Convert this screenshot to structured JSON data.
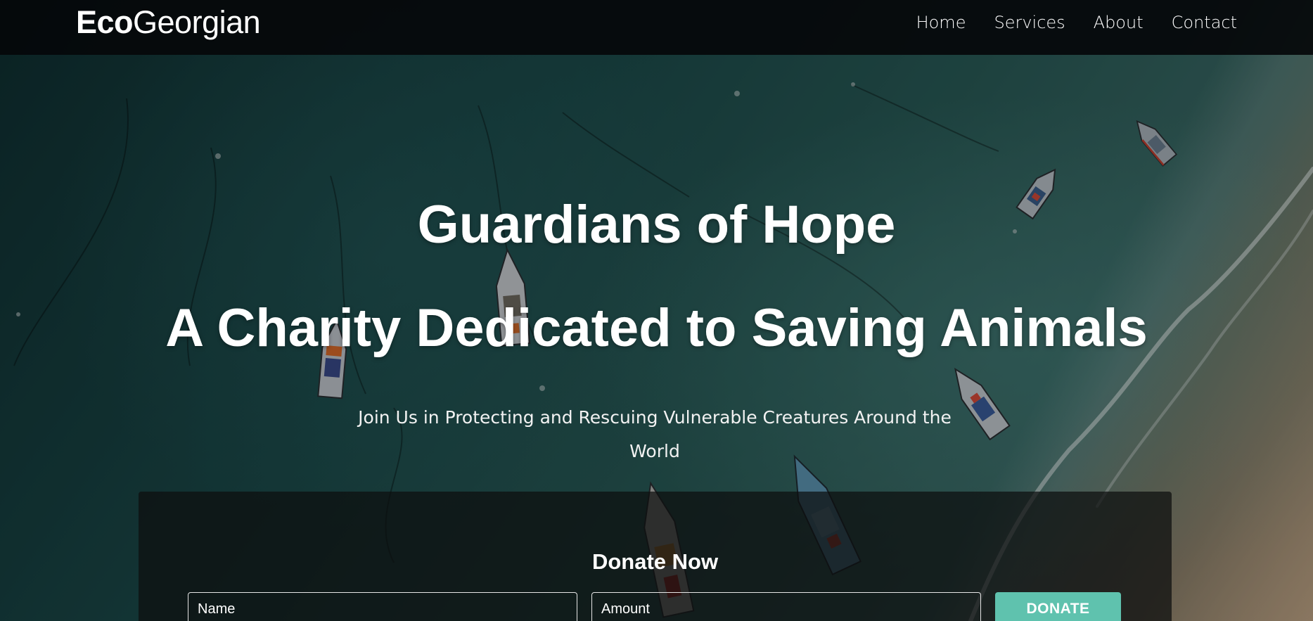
{
  "brand": {
    "logo_bold": "Eco",
    "logo_regular": "Georgian"
  },
  "nav": {
    "items": [
      {
        "label": "Home"
      },
      {
        "label": "Services"
      },
      {
        "label": "About"
      },
      {
        "label": "Contact"
      }
    ]
  },
  "hero": {
    "title_line1": "Guardians of Hope",
    "title_line2": "A Charity Dedicated to Saving Animals",
    "subtitle": "Join Us in Protecting and Rescuing Vulnerable Creatures Around the World"
  },
  "donate": {
    "heading": "Donate Now",
    "name_placeholder": "Name",
    "amount_placeholder": "Amount",
    "button_label": "DONATE"
  },
  "colors": {
    "accent": "#5fc2ae",
    "nav_bg": "#05080a",
    "water": "#1b4a4a"
  }
}
